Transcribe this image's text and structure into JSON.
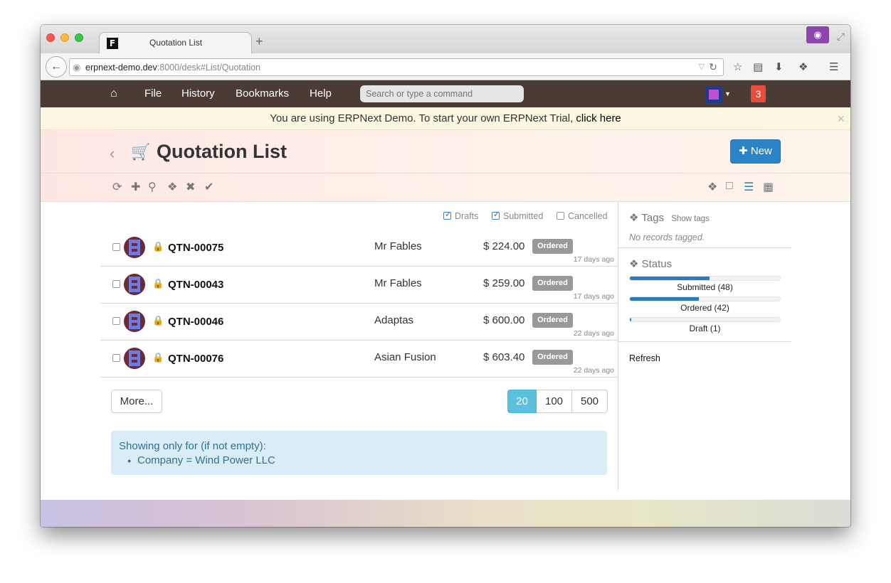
{
  "browser": {
    "tab_title": "Quotation List",
    "favicon_letter": "F",
    "new_tab_symbol": "+",
    "url_host": "erpnext-demo.dev",
    "url_path": ":8000/desk#List/Quotation"
  },
  "navbar": {
    "items": [
      "File",
      "History",
      "Bookmarks",
      "Help"
    ],
    "search_placeholder": "Search or type a command",
    "notification_count": "3"
  },
  "banner": {
    "text": "You are using ERPNext Demo. To start your own ERPNext Trial, ",
    "link": "click here",
    "close": "×"
  },
  "page": {
    "title": "Quotation List",
    "new_button": "New"
  },
  "filters": {
    "drafts": "Drafts",
    "submitted": "Submitted",
    "cancelled": "Cancelled"
  },
  "rows": [
    {
      "name": "QTN-00075",
      "customer": "Mr Fables",
      "amount": "$ 224.00",
      "status": "Ordered",
      "time": "17 days ago"
    },
    {
      "name": "QTN-00043",
      "customer": "Mr Fables",
      "amount": "$ 259.00",
      "status": "Ordered",
      "time": "17 days ago"
    },
    {
      "name": "QTN-00046",
      "customer": "Adaptas",
      "amount": "$ 600.00",
      "status": "Ordered",
      "time": "22 days ago"
    },
    {
      "name": "QTN-00076",
      "customer": "Asian Fusion",
      "amount": "$ 603.40",
      "status": "Ordered",
      "time": "22 days ago"
    }
  ],
  "more_button": "More...",
  "page_sizes": [
    "20",
    "100",
    "500"
  ],
  "info": {
    "heading": "Showing only for (if not empty):",
    "item": "Company = Wind Power LLC"
  },
  "sidebar": {
    "tags_heading": "Tags",
    "show_tags": "Show tags",
    "no_tags": "No records tagged.",
    "status_heading": "Status",
    "status_bars": [
      {
        "label": "Submitted (48)",
        "fraction": 0.53
      },
      {
        "label": "Ordered (42)",
        "fraction": 0.46
      },
      {
        "label": "Draft (1)",
        "fraction": 0.01
      }
    ],
    "refresh": "Refresh"
  },
  "colors": {
    "navbar": "#4a3b34",
    "primary": "#2b84c8",
    "pager_active": "#5bc0de",
    "badge": "#e74c3c"
  }
}
